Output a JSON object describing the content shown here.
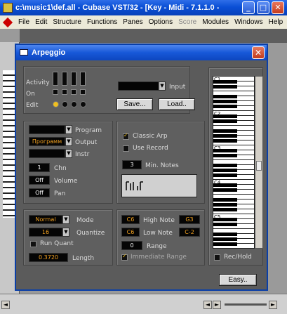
{
  "app": {
    "title": "c:\\music1\\def.all - Cubase VST/32 - [Key - Midi - 7.1.1.0 -",
    "menu": [
      "File",
      "Edit",
      "Structure",
      "Functions",
      "Panes",
      "Options",
      "Score",
      "Modules",
      "Windows",
      "Help"
    ],
    "menu_disabled": [
      6
    ]
  },
  "dialog": {
    "title": "Arpeggio",
    "activity_label": "Activity",
    "on_label": "On",
    "edit_label": "Edit",
    "input_label": "Input",
    "input_value": "",
    "save_button": "Save...",
    "load_button": "Load..",
    "program_label": "Program",
    "program_value": "",
    "output_label": "Output",
    "output_value": "Программ",
    "instr_label": "Instr",
    "instr_value": "",
    "chn_label": "Chn",
    "chn_value": "1",
    "volume_label": "Volume",
    "volume_value": "Off",
    "pan_label": "Pan",
    "pan_value": "Off",
    "classic_arp_label": "Classic Arp",
    "classic_arp_checked": true,
    "use_record_label": "Use Record",
    "use_record_checked": false,
    "min_notes_label": "Min. Notes",
    "min_notes_value": "3",
    "mode_label": "Mode",
    "mode_value": "Normal",
    "quantize_label": "Quantize",
    "quantize_value": "16",
    "run_quant_label": "Run Quant",
    "run_quant_checked": false,
    "length_label": "Length",
    "length_value": "0.3720",
    "high_note_label": "High Note",
    "high_note_from": "C6",
    "high_note_value": "G3",
    "low_note_label": "Low Note",
    "low_note_from": "C6",
    "low_note_value": "C-2",
    "range_label": "Range",
    "range_value": "0",
    "immediate_range_label": "Immediate Range",
    "immediate_range_checked": true,
    "rec_hold_label": "Rec/Hold",
    "easy_button": "Easy..",
    "octaves": [
      "C1",
      "C2",
      "C3",
      "C4",
      "C5"
    ]
  },
  "colors": {
    "titlebar": "#0a4fd6",
    "dialog_bg": "#5b5b5b",
    "accent_orange": "#f0a020",
    "edit_dot_active": "#f0c020"
  }
}
